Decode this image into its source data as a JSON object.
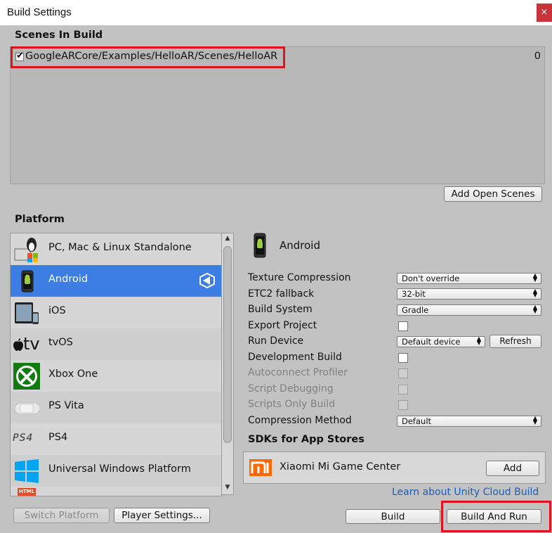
{
  "window": {
    "title": "Build Settings",
    "close_glyph": "×"
  },
  "scenes": {
    "header": "Scenes In Build",
    "items": [
      {
        "path": "GoogleARCore/Examples/HelloAR/Scenes/HelloAR",
        "index": "0",
        "checked": true
      }
    ],
    "add_open_scenes_label": "Add Open Scenes"
  },
  "platform": {
    "header": "Platform",
    "items": [
      {
        "label": "PC, Mac & Linux Standalone",
        "icon": "pc-mac-linux-icon"
      },
      {
        "label": "Android",
        "icon": "android-icon",
        "selected": true
      },
      {
        "label": "iOS",
        "icon": "ios-icon"
      },
      {
        "label": "tvOS",
        "icon": "tvos-icon"
      },
      {
        "label": "Xbox One",
        "icon": "xbox-icon"
      },
      {
        "label": "PS Vita",
        "icon": "ps-vita-icon"
      },
      {
        "label": "PS4",
        "icon": "ps4-icon"
      },
      {
        "label": "Universal Windows Platform",
        "icon": "windows-icon"
      }
    ],
    "html_icon_text": "HTML",
    "ps4_icon_text": "PS4",
    "tvos_icon_text": "tv",
    "switch_platform_label": "Switch Platform",
    "player_settings_label": "Player Settings..."
  },
  "android": {
    "header": "Android",
    "settings": [
      {
        "label": "Texture Compression",
        "type": "dropdown",
        "value": "Don't override"
      },
      {
        "label": "ETC2 fallback",
        "type": "dropdown",
        "value": "32-bit"
      },
      {
        "label": "Build System",
        "type": "dropdown",
        "value": "Gradle"
      },
      {
        "label": "Export Project",
        "type": "checkbox",
        "checked": false
      },
      {
        "label": "Run Device",
        "type": "dropdown",
        "value": "Default device"
      },
      {
        "label": "Development Build",
        "type": "checkbox",
        "checked": false
      },
      {
        "label": "Autoconnect Profiler",
        "type": "checkbox",
        "disabled": true
      },
      {
        "label": "Script Debugging",
        "type": "checkbox",
        "disabled": true
      },
      {
        "label": "Scripts Only Build",
        "type": "checkbox",
        "disabled": true
      },
      {
        "label": "Compression Method",
        "type": "dropdown",
        "value": "Default"
      }
    ],
    "refresh_label": "Refresh",
    "sdk_header": "SDKs for App Stores",
    "sdk_name": "Xiaomi Mi Game Center",
    "sdk_add_label": "Add",
    "cloud_link": "Learn about Unity Cloud Build",
    "build_label": "Build",
    "build_and_run_label": "Build And Run"
  },
  "colors": {
    "selection": "#3c7ee4",
    "highlight_red": "#e0121e",
    "close": "#c8343a",
    "link": "#1c5db8"
  }
}
